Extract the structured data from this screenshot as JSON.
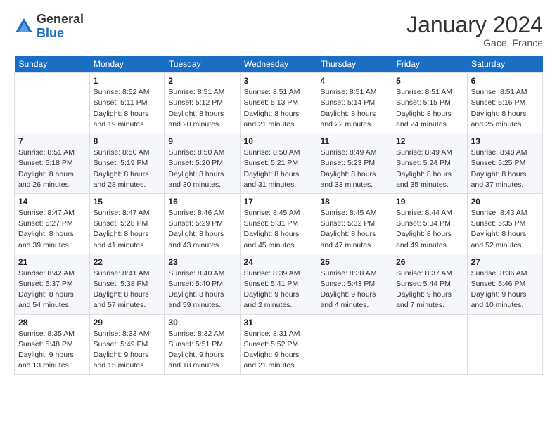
{
  "logo": {
    "general": "General",
    "blue": "Blue"
  },
  "title": "January 2024",
  "location": "Gace, France",
  "days_of_week": [
    "Sunday",
    "Monday",
    "Tuesday",
    "Wednesday",
    "Thursday",
    "Friday",
    "Saturday"
  ],
  "weeks": [
    [
      {
        "day": "",
        "info": ""
      },
      {
        "day": "1",
        "info": "Sunrise: 8:52 AM\nSunset: 5:11 PM\nDaylight: 8 hours\nand 19 minutes."
      },
      {
        "day": "2",
        "info": "Sunrise: 8:51 AM\nSunset: 5:12 PM\nDaylight: 8 hours\nand 20 minutes."
      },
      {
        "day": "3",
        "info": "Sunrise: 8:51 AM\nSunset: 5:13 PM\nDaylight: 8 hours\nand 21 minutes."
      },
      {
        "day": "4",
        "info": "Sunrise: 8:51 AM\nSunset: 5:14 PM\nDaylight: 8 hours\nand 22 minutes."
      },
      {
        "day": "5",
        "info": "Sunrise: 8:51 AM\nSunset: 5:15 PM\nDaylight: 8 hours\nand 24 minutes."
      },
      {
        "day": "6",
        "info": "Sunrise: 8:51 AM\nSunset: 5:16 PM\nDaylight: 8 hours\nand 25 minutes."
      }
    ],
    [
      {
        "day": "7",
        "info": "Sunrise: 8:51 AM\nSunset: 5:18 PM\nDaylight: 8 hours\nand 26 minutes."
      },
      {
        "day": "8",
        "info": "Sunrise: 8:50 AM\nSunset: 5:19 PM\nDaylight: 8 hours\nand 28 minutes."
      },
      {
        "day": "9",
        "info": "Sunrise: 8:50 AM\nSunset: 5:20 PM\nDaylight: 8 hours\nand 30 minutes."
      },
      {
        "day": "10",
        "info": "Sunrise: 8:50 AM\nSunset: 5:21 PM\nDaylight: 8 hours\nand 31 minutes."
      },
      {
        "day": "11",
        "info": "Sunrise: 8:49 AM\nSunset: 5:23 PM\nDaylight: 8 hours\nand 33 minutes."
      },
      {
        "day": "12",
        "info": "Sunrise: 8:49 AM\nSunset: 5:24 PM\nDaylight: 8 hours\nand 35 minutes."
      },
      {
        "day": "13",
        "info": "Sunrise: 8:48 AM\nSunset: 5:25 PM\nDaylight: 8 hours\nand 37 minutes."
      }
    ],
    [
      {
        "day": "14",
        "info": "Sunrise: 8:47 AM\nSunset: 5:27 PM\nDaylight: 8 hours\nand 39 minutes."
      },
      {
        "day": "15",
        "info": "Sunrise: 8:47 AM\nSunset: 5:28 PM\nDaylight: 8 hours\nand 41 minutes."
      },
      {
        "day": "16",
        "info": "Sunrise: 8:46 AM\nSunset: 5:29 PM\nDaylight: 8 hours\nand 43 minutes."
      },
      {
        "day": "17",
        "info": "Sunrise: 8:45 AM\nSunset: 5:31 PM\nDaylight: 8 hours\nand 45 minutes."
      },
      {
        "day": "18",
        "info": "Sunrise: 8:45 AM\nSunset: 5:32 PM\nDaylight: 8 hours\nand 47 minutes."
      },
      {
        "day": "19",
        "info": "Sunrise: 8:44 AM\nSunset: 5:34 PM\nDaylight: 8 hours\nand 49 minutes."
      },
      {
        "day": "20",
        "info": "Sunrise: 8:43 AM\nSunset: 5:35 PM\nDaylight: 8 hours\nand 52 minutes."
      }
    ],
    [
      {
        "day": "21",
        "info": "Sunrise: 8:42 AM\nSunset: 5:37 PM\nDaylight: 8 hours\nand 54 minutes."
      },
      {
        "day": "22",
        "info": "Sunrise: 8:41 AM\nSunset: 5:38 PM\nDaylight: 8 hours\nand 57 minutes."
      },
      {
        "day": "23",
        "info": "Sunrise: 8:40 AM\nSunset: 5:40 PM\nDaylight: 8 hours\nand 59 minutes."
      },
      {
        "day": "24",
        "info": "Sunrise: 8:39 AM\nSunset: 5:41 PM\nDaylight: 9 hours\nand 2 minutes."
      },
      {
        "day": "25",
        "info": "Sunrise: 8:38 AM\nSunset: 5:43 PM\nDaylight: 9 hours\nand 4 minutes."
      },
      {
        "day": "26",
        "info": "Sunrise: 8:37 AM\nSunset: 5:44 PM\nDaylight: 9 hours\nand 7 minutes."
      },
      {
        "day": "27",
        "info": "Sunrise: 8:36 AM\nSunset: 5:46 PM\nDaylight: 9 hours\nand 10 minutes."
      }
    ],
    [
      {
        "day": "28",
        "info": "Sunrise: 8:35 AM\nSunset: 5:48 PM\nDaylight: 9 hours\nand 13 minutes."
      },
      {
        "day": "29",
        "info": "Sunrise: 8:33 AM\nSunset: 5:49 PM\nDaylight: 9 hours\nand 15 minutes."
      },
      {
        "day": "30",
        "info": "Sunrise: 8:32 AM\nSunset: 5:51 PM\nDaylight: 9 hours\nand 18 minutes."
      },
      {
        "day": "31",
        "info": "Sunrise: 8:31 AM\nSunset: 5:52 PM\nDaylight: 9 hours\nand 21 minutes."
      },
      {
        "day": "",
        "info": ""
      },
      {
        "day": "",
        "info": ""
      },
      {
        "day": "",
        "info": ""
      }
    ]
  ]
}
